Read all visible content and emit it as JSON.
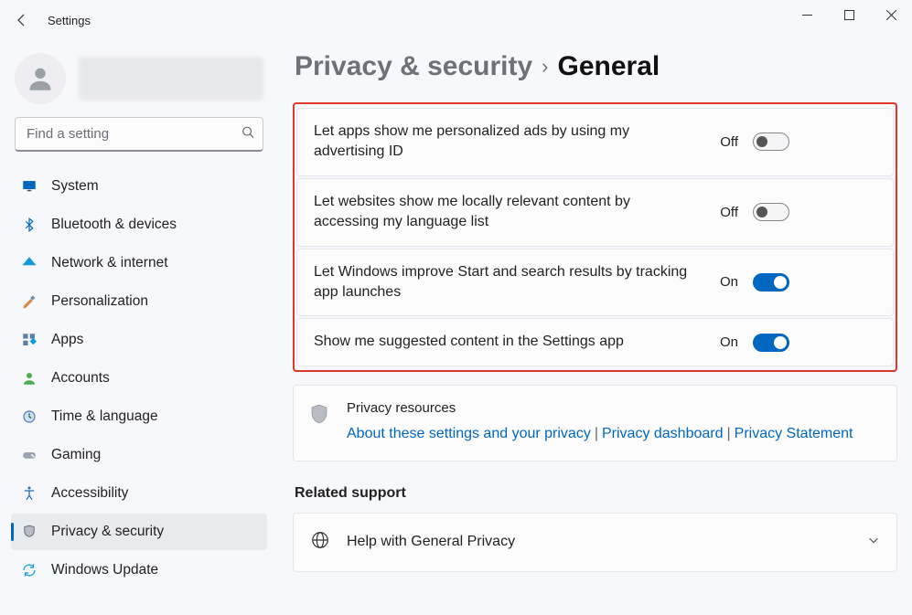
{
  "app_title": "Settings",
  "search": {
    "placeholder": "Find a setting"
  },
  "nav": [
    {
      "id": "system",
      "label": "System",
      "icon": "monitor"
    },
    {
      "id": "bluetooth",
      "label": "Bluetooth & devices",
      "icon": "bluetooth"
    },
    {
      "id": "network",
      "label": "Network & internet",
      "icon": "wifi"
    },
    {
      "id": "personalize",
      "label": "Personalization",
      "icon": "brush"
    },
    {
      "id": "apps",
      "label": "Apps",
      "icon": "apps"
    },
    {
      "id": "accounts",
      "label": "Accounts",
      "icon": "person"
    },
    {
      "id": "time",
      "label": "Time & language",
      "icon": "globe-clock"
    },
    {
      "id": "gaming",
      "label": "Gaming",
      "icon": "gamepad"
    },
    {
      "id": "accessibility",
      "label": "Accessibility",
      "icon": "accessibility"
    },
    {
      "id": "privacy",
      "label": "Privacy & security",
      "icon": "shield",
      "selected": true
    },
    {
      "id": "update",
      "label": "Windows Update",
      "icon": "update"
    }
  ],
  "breadcrumb": {
    "parent": "Privacy & security",
    "current": "General"
  },
  "toggles": [
    {
      "label": "Let apps show me personalized ads by using my advertising ID",
      "state_text": "Off",
      "on": false
    },
    {
      "label": "Let websites show me locally relevant content by accessing my language list",
      "state_text": "Off",
      "on": false
    },
    {
      "label": "Let Windows improve Start and search results by tracking app launches",
      "state_text": "On",
      "on": true
    },
    {
      "label": "Show me suggested content in the Settings app",
      "state_text": "On",
      "on": true
    }
  ],
  "resources": {
    "heading": "Privacy resources",
    "links": [
      "About these settings and your privacy",
      "Privacy dashboard",
      "Privacy Statement"
    ]
  },
  "related": {
    "heading": "Related support",
    "help_label": "Help with General Privacy"
  },
  "colors": {
    "accent": "#0067c0",
    "highlight_box": "#e2362a"
  }
}
